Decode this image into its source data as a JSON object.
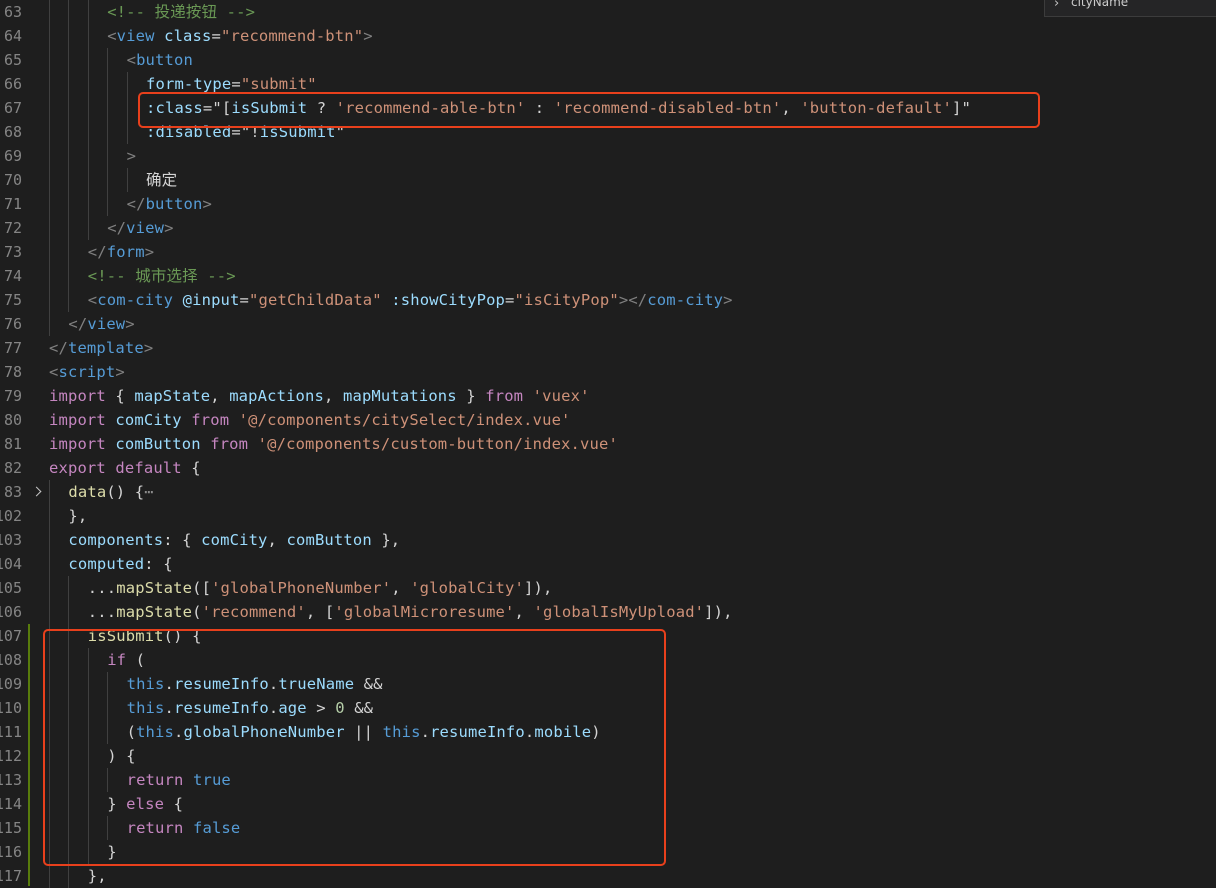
{
  "find_widget": {
    "value": "cityName"
  },
  "lines": [
    {
      "n": "63",
      "ind": 3,
      "t": [
        [
          "cm",
          "<!-- 投递按钮 -->"
        ]
      ]
    },
    {
      "n": "64",
      "ind": 3,
      "t": [
        [
          "br",
          "<"
        ],
        [
          "tag",
          "view"
        ],
        [
          "def",
          " "
        ],
        [
          "attr",
          "class"
        ],
        [
          "def",
          "="
        ],
        [
          "str",
          "\"recommend-btn\""
        ],
        [
          "br",
          ">"
        ]
      ]
    },
    {
      "n": "65",
      "ind": 4,
      "t": [
        [
          "br",
          "<"
        ],
        [
          "tag",
          "button"
        ]
      ]
    },
    {
      "n": "66",
      "ind": 5,
      "t": [
        [
          "attr",
          "form-type"
        ],
        [
          "def",
          "="
        ],
        [
          "str",
          "\"submit\""
        ]
      ]
    },
    {
      "n": "67",
      "ind": 5,
      "t": [
        [
          "attr",
          ":class"
        ],
        [
          "def",
          "=\"["
        ],
        [
          "var",
          "isSubmit"
        ],
        [
          "def",
          " ? "
        ],
        [
          "str",
          "'recommend-able-btn'"
        ],
        [
          "def",
          " : "
        ],
        [
          "str",
          "'recommend-disabled-btn'"
        ],
        [
          "def",
          ", "
        ],
        [
          "str",
          "'button-default'"
        ],
        [
          "def",
          "]\""
        ]
      ]
    },
    {
      "n": "68",
      "ind": 5,
      "t": [
        [
          "attr",
          ":disabled"
        ],
        [
          "def",
          "=\"!"
        ],
        [
          "var",
          "isSubmit"
        ],
        [
          "def",
          "\""
        ]
      ]
    },
    {
      "n": "69",
      "ind": 4,
      "t": [
        [
          "br",
          ">"
        ]
      ]
    },
    {
      "n": "70",
      "ind": 5,
      "t": [
        [
          "def",
          "确定"
        ]
      ]
    },
    {
      "n": "71",
      "ind": 4,
      "t": [
        [
          "br",
          "</"
        ],
        [
          "tag",
          "button"
        ],
        [
          "br",
          ">"
        ]
      ]
    },
    {
      "n": "72",
      "ind": 3,
      "t": [
        [
          "br",
          "</"
        ],
        [
          "tag",
          "view"
        ],
        [
          "br",
          ">"
        ]
      ]
    },
    {
      "n": "73",
      "ind": 2,
      "t": [
        [
          "br",
          "</"
        ],
        [
          "tag",
          "form"
        ],
        [
          "br",
          ">"
        ]
      ]
    },
    {
      "n": "74",
      "ind": 2,
      "t": [
        [
          "cm",
          "<!-- 城市选择 -->"
        ]
      ]
    },
    {
      "n": "75",
      "ind": 2,
      "t": [
        [
          "br",
          "<"
        ],
        [
          "tag",
          "com-city"
        ],
        [
          "def",
          " "
        ],
        [
          "attr",
          "@input"
        ],
        [
          "def",
          "="
        ],
        [
          "str",
          "\"getChildData\""
        ],
        [
          "def",
          " "
        ],
        [
          "attr",
          ":showCityPop"
        ],
        [
          "def",
          "="
        ],
        [
          "str",
          "\"isCityPop\""
        ],
        [
          "br",
          "></"
        ],
        [
          "tag",
          "com-city"
        ],
        [
          "br",
          ">"
        ]
      ]
    },
    {
      "n": "76",
      "ind": 1,
      "t": [
        [
          "br",
          "</"
        ],
        [
          "tag",
          "view"
        ],
        [
          "br",
          ">"
        ]
      ]
    },
    {
      "n": "77",
      "ind": 0,
      "t": [
        [
          "br",
          "</"
        ],
        [
          "tag",
          "template"
        ],
        [
          "br",
          ">"
        ]
      ]
    },
    {
      "n": "78",
      "ind": 0,
      "t": [
        [
          "br",
          "<"
        ],
        [
          "tag",
          "script"
        ],
        [
          "br",
          ">"
        ]
      ]
    },
    {
      "n": "79",
      "ind": 0,
      "t": [
        [
          "kw",
          "import"
        ],
        [
          "def",
          " { "
        ],
        [
          "var",
          "mapState"
        ],
        [
          "def",
          ", "
        ],
        [
          "var",
          "mapActions"
        ],
        [
          "def",
          ", "
        ],
        [
          "var",
          "mapMutations"
        ],
        [
          "def",
          " } "
        ],
        [
          "kw",
          "from"
        ],
        [
          "def",
          " "
        ],
        [
          "str",
          "'vuex'"
        ]
      ]
    },
    {
      "n": "80",
      "ind": 0,
      "t": [
        [
          "kw",
          "import"
        ],
        [
          "def",
          " "
        ],
        [
          "var",
          "comCity"
        ],
        [
          "def",
          " "
        ],
        [
          "kw",
          "from"
        ],
        [
          "def",
          " "
        ],
        [
          "str",
          "'@/components/citySelect/index.vue'"
        ]
      ]
    },
    {
      "n": "81",
      "ind": 0,
      "t": [
        [
          "kw",
          "import"
        ],
        [
          "def",
          " "
        ],
        [
          "var",
          "comButton"
        ],
        [
          "def",
          " "
        ],
        [
          "kw",
          "from"
        ],
        [
          "def",
          " "
        ],
        [
          "str",
          "'@/components/custom-button/index.vue'"
        ]
      ]
    },
    {
      "n": "82",
      "ind": 0,
      "t": [
        [
          "kw",
          "export"
        ],
        [
          "def",
          " "
        ],
        [
          "kw",
          "default"
        ],
        [
          "def",
          " {"
        ]
      ]
    },
    {
      "n": "83",
      "ind": 1,
      "fold": true,
      "t": [
        [
          "fn",
          "data"
        ],
        [
          "def",
          "() {"
        ],
        [
          "dim",
          "⋯"
        ]
      ]
    },
    {
      "n": "102",
      "ind": 1,
      "t": [
        [
          "def",
          "},"
        ]
      ]
    },
    {
      "n": "103",
      "ind": 1,
      "t": [
        [
          "var",
          "components"
        ],
        [
          "def",
          ": { "
        ],
        [
          "var",
          "comCity"
        ],
        [
          "def",
          ", "
        ],
        [
          "var",
          "comButton"
        ],
        [
          "def",
          " },"
        ]
      ]
    },
    {
      "n": "104",
      "ind": 1,
      "t": [
        [
          "var",
          "computed"
        ],
        [
          "def",
          ": {"
        ]
      ]
    },
    {
      "n": "105",
      "ind": 2,
      "t": [
        [
          "def",
          "..."
        ],
        [
          "fn",
          "mapState"
        ],
        [
          "def",
          "(["
        ],
        [
          "str",
          "'globalPhoneNumber'"
        ],
        [
          "def",
          ", "
        ],
        [
          "str",
          "'globalCity'"
        ],
        [
          "def",
          "]),"
        ]
      ]
    },
    {
      "n": "106",
      "ind": 2,
      "t": [
        [
          "def",
          "..."
        ],
        [
          "fn",
          "mapState"
        ],
        [
          "def",
          "("
        ],
        [
          "str",
          "'recommend'"
        ],
        [
          "def",
          ", ["
        ],
        [
          "str",
          "'globalMicroresume'"
        ],
        [
          "def",
          ", "
        ],
        [
          "str",
          "'globalIsMyUpload'"
        ],
        [
          "def",
          "]),"
        ]
      ]
    },
    {
      "n": "107",
      "ind": 2,
      "t": [
        [
          "fn",
          "isSubmit"
        ],
        [
          "def",
          "() {"
        ]
      ]
    },
    {
      "n": "108",
      "ind": 3,
      "t": [
        [
          "kw",
          "if"
        ],
        [
          "def",
          " ("
        ]
      ]
    },
    {
      "n": "109",
      "ind": 4,
      "t": [
        [
          "bl",
          "this"
        ],
        [
          "def",
          "."
        ],
        [
          "var",
          "resumeInfo"
        ],
        [
          "def",
          "."
        ],
        [
          "var",
          "trueName"
        ],
        [
          "def",
          " &&"
        ]
      ]
    },
    {
      "n": "110",
      "ind": 4,
      "t": [
        [
          "bl",
          "this"
        ],
        [
          "def",
          "."
        ],
        [
          "var",
          "resumeInfo"
        ],
        [
          "def",
          "."
        ],
        [
          "var",
          "age"
        ],
        [
          "def",
          " > "
        ],
        [
          "num",
          "0"
        ],
        [
          "def",
          " &&"
        ]
      ]
    },
    {
      "n": "111",
      "ind": 4,
      "t": [
        [
          "def",
          "("
        ],
        [
          "bl",
          "this"
        ],
        [
          "def",
          "."
        ],
        [
          "var",
          "globalPhoneNumber"
        ],
        [
          "def",
          " || "
        ],
        [
          "bl",
          "this"
        ],
        [
          "def",
          "."
        ],
        [
          "var",
          "resumeInfo"
        ],
        [
          "def",
          "."
        ],
        [
          "var",
          "mobile"
        ],
        [
          "def",
          ")"
        ]
      ]
    },
    {
      "n": "112",
      "ind": 3,
      "t": [
        [
          "def",
          ") {"
        ]
      ]
    },
    {
      "n": "113",
      "ind": 4,
      "t": [
        [
          "kw",
          "return"
        ],
        [
          "def",
          " "
        ],
        [
          "bl",
          "true"
        ]
      ]
    },
    {
      "n": "114",
      "ind": 3,
      "t": [
        [
          "def",
          "} "
        ],
        [
          "kw",
          "else"
        ],
        [
          "def",
          " {"
        ]
      ]
    },
    {
      "n": "115",
      "ind": 4,
      "t": [
        [
          "kw",
          "return"
        ],
        [
          "def",
          " "
        ],
        [
          "bl",
          "false"
        ]
      ]
    },
    {
      "n": "116",
      "ind": 3,
      "t": [
        [
          "def",
          "}"
        ]
      ]
    },
    {
      "n": "117",
      "ind": 2,
      "t": [
        [
          "def",
          "},"
        ]
      ]
    }
  ]
}
